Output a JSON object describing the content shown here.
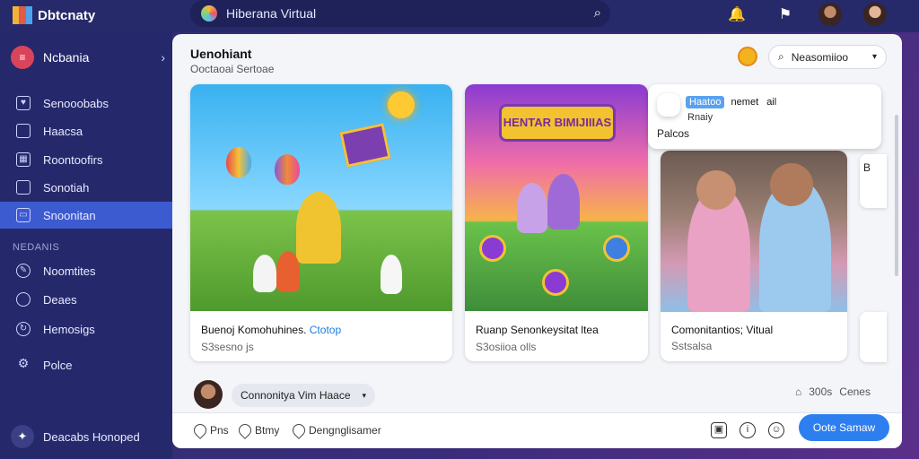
{
  "topbar": {
    "logo_text": "Dbtcnaty",
    "search_text": "Hiberana Virtual",
    "icons": [
      "search-icon",
      "bell-icon",
      "notification-icon"
    ]
  },
  "sidebar": {
    "header_label": "Ncbania",
    "items": [
      {
        "label": "Senooobabs",
        "icon": "heart-icon"
      },
      {
        "label": "Haacsa",
        "icon": "document-icon"
      },
      {
        "label": "Roontoofirs",
        "icon": "grid-icon"
      },
      {
        "label": "Sonotiah",
        "icon": "folder-icon"
      },
      {
        "label": "Snoonitan",
        "icon": "screen-icon",
        "active": true
      }
    ],
    "section_label": "NEDANIS",
    "items2": [
      {
        "label": "Noomtites",
        "icon": "pencil-icon"
      },
      {
        "label": "Deaes",
        "icon": "chat-icon"
      },
      {
        "label": "Hemosigs",
        "icon": "settings-icon"
      },
      {
        "label": "Polce",
        "icon": "gear-icon"
      }
    ],
    "bottom_label": "Deacabs Honoped"
  },
  "main": {
    "title": "Uenohiant",
    "subtitle": "Ooctaoai Sertoae",
    "sort_label": "Neasomiioo",
    "cards": [
      {
        "caption": "Buenoj Komohuhines.",
        "caption_link": "Ctotop",
        "meta": "S3sesno js"
      },
      {
        "caption": "Ruanp Senonkeysitat ltea",
        "meta": "S3osiioa olls",
        "banner": "HENTAR BIMIJIIIAS"
      },
      {
        "caption": "Comonitantios; Vitual",
        "meta": "Sstsalsa"
      }
    ],
    "chat": {
      "tag": "Haatoo",
      "tag_rest": "nemet",
      "tag_end": "ail",
      "line2": "Rnaiy",
      "line3": "Palcos"
    },
    "side_card_text": "B",
    "community_label": "Connonitya Vim Haace",
    "stats": {
      "count": "300s",
      "label": "Cenes"
    },
    "actions": [
      "Pns",
      "Btmy",
      "Dengnglisamer"
    ],
    "cta_label": "Oote Samaw"
  },
  "colors": {
    "topbar": "#26296a",
    "sidebar": "#25296b",
    "active": "#3d5bd0",
    "cta": "#2d7ff0"
  }
}
